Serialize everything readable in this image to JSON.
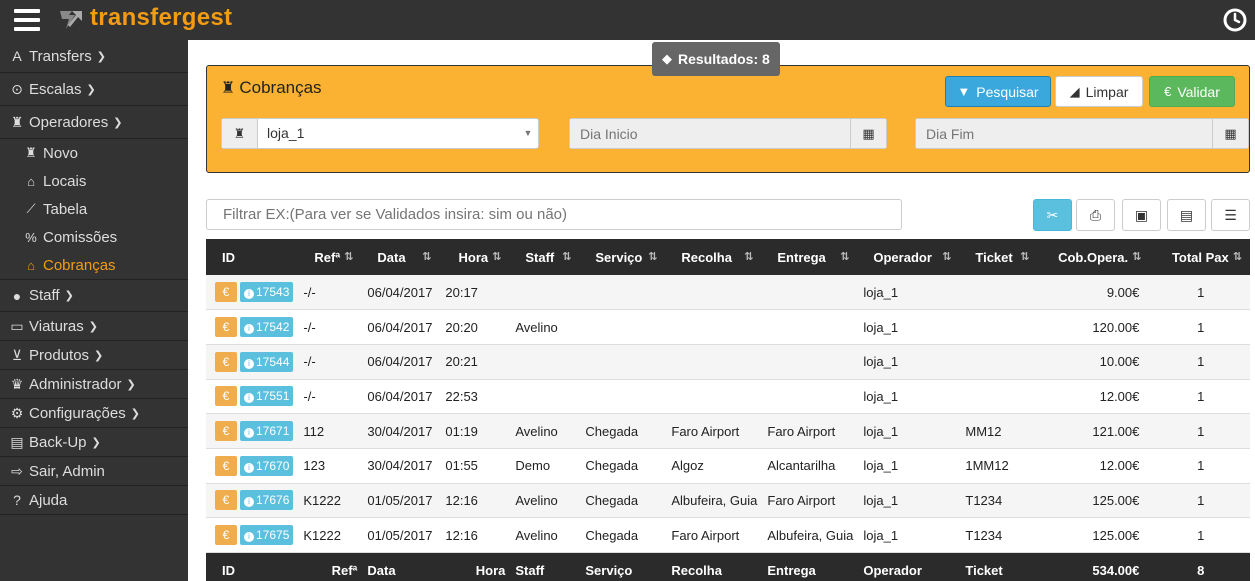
{
  "app": {
    "brand": "transfergest"
  },
  "sidebar": {
    "items": [
      {
        "label": "Transfers",
        "icon": "plane-icon",
        "glyph": "✈",
        "chevron": true
      },
      {
        "label": "Escalas",
        "icon": "clock-icon",
        "glyph": "⏲",
        "chevron": true
      },
      {
        "label": "Operadores",
        "icon": "chess-piece-icon",
        "glyph": "♜",
        "chevron": true
      }
    ],
    "sub_items": [
      {
        "label": "Novo",
        "icon": "chess-piece-icon",
        "glyph": "♜"
      },
      {
        "label": "Locais",
        "icon": "home-icon",
        "glyph": "⌂"
      },
      {
        "label": "Tabela",
        "icon": "line-chart-icon",
        "glyph": "📈"
      },
      {
        "label": "Comissões",
        "icon": "percent-icon",
        "glyph": "%"
      },
      {
        "label": "Cobranças",
        "icon": "bank-icon",
        "glyph": "🏛"
      }
    ],
    "items_bottom": [
      {
        "label": "Staff",
        "icon": "user-icon",
        "glyph": "👤",
        "chevron": true
      },
      {
        "label": "Viaturas",
        "icon": "car-icon",
        "glyph": "🚗",
        "chevron": true
      },
      {
        "label": "Produtos",
        "icon": "cart-icon",
        "glyph": "🛒",
        "chevron": true
      },
      {
        "label": "Administrador",
        "icon": "admin-icon",
        "glyph": "♛",
        "chevron": true
      },
      {
        "label": "Configurações",
        "icon": "gear-icon",
        "glyph": "⚙",
        "chevron": true
      },
      {
        "label": "Back-Up",
        "icon": "backup-icon",
        "glyph": "💾",
        "chevron": true
      },
      {
        "label": "Sair, Admin",
        "icon": "logout-icon",
        "glyph": "⇨",
        "chevron": false
      },
      {
        "label": "Ajuda",
        "icon": "help-icon",
        "glyph": "?",
        "chevron": false
      }
    ]
  },
  "results_badge": "Resultados: 8",
  "panel": {
    "title": "Cobranças",
    "search_label": "Pesquisar",
    "clear_label": "Limpar",
    "validate_label": "Validar",
    "operator_value": "loja_1",
    "date_start_placeholder": "Dia Inicio",
    "date_end_placeholder": "Dia Fim"
  },
  "filter_placeholder": "Filtrar EX:(Para ver se Validados insira: sim ou não)",
  "table": {
    "headers": [
      "ID",
      "Refª",
      "Data",
      "Hora",
      "Staff",
      "Serviço",
      "Recolha",
      "Entrega",
      "Operador",
      "Ticket",
      "Cob.Opera.",
      "Total Pax"
    ],
    "rows": [
      {
        "id": "17543",
        "ref": "-/-",
        "data": "06/04/2017",
        "hora": "20:17",
        "staff": "",
        "servico": "",
        "recolha": "",
        "entrega": "",
        "operador": "loja_1",
        "ticket": "",
        "cob": "9.00€",
        "pax": "1"
      },
      {
        "id": "17542",
        "ref": "-/-",
        "data": "06/04/2017",
        "hora": "20:20",
        "staff": "Avelino",
        "servico": "",
        "recolha": "",
        "entrega": "",
        "operador": "loja_1",
        "ticket": "",
        "cob": "120.00€",
        "pax": "1"
      },
      {
        "id": "17544",
        "ref": "-/-",
        "data": "06/04/2017",
        "hora": "20:21",
        "staff": "",
        "servico": "",
        "recolha": "",
        "entrega": "",
        "operador": "loja_1",
        "ticket": "",
        "cob": "10.00€",
        "pax": "1"
      },
      {
        "id": "17551",
        "ref": "-/-",
        "data": "06/04/2017",
        "hora": "22:53",
        "staff": "",
        "servico": "",
        "recolha": "",
        "entrega": "",
        "operador": "loja_1",
        "ticket": "",
        "cob": "12.00€",
        "pax": "1"
      },
      {
        "id": "17671",
        "ref": "112",
        "data": "30/04/2017",
        "hora": "01:19",
        "staff": "Avelino",
        "servico": "Chegada",
        "recolha": "Faro Airport",
        "entrega": "Faro Airport",
        "operador": "loja_1",
        "ticket": "MM12",
        "cob": "121.00€",
        "pax": "1"
      },
      {
        "id": "17670",
        "ref": "123",
        "data": "30/04/2017",
        "hora": "01:55",
        "staff": "Demo",
        "servico": "Chegada",
        "recolha": "Algoz",
        "entrega": "Alcantarilha",
        "operador": "loja_1",
        "ticket": "1MM12",
        "cob": "12.00€",
        "pax": "1"
      },
      {
        "id": "17676",
        "ref": "K1222",
        "data": "01/05/2017",
        "hora": "12:16",
        "staff": "Avelino",
        "servico": "Chegada",
        "recolha": "Albufeira, Guia",
        "entrega": "Faro Airport",
        "operador": "loja_1",
        "ticket": "T1234",
        "cob": "125.00€",
        "pax": "1"
      },
      {
        "id": "17675",
        "ref": "K1222",
        "data": "01/05/2017",
        "hora": "12:16",
        "staff": "Avelino",
        "servico": "Chegada",
        "recolha": "Faro Airport",
        "entrega": "Albufeira, Guia",
        "operador": "loja_1",
        "ticket": "T1234",
        "cob": "125.00€",
        "pax": "1"
      }
    ],
    "footer": {
      "total_cob": "534.00€",
      "total_pax": "8"
    }
  },
  "colors": {
    "accent": "#f39c12",
    "panel": "#fbb232",
    "dark": "#333333",
    "info": "#5bc0de",
    "success": "#5cb85c",
    "warning": "#f0ad4e"
  }
}
